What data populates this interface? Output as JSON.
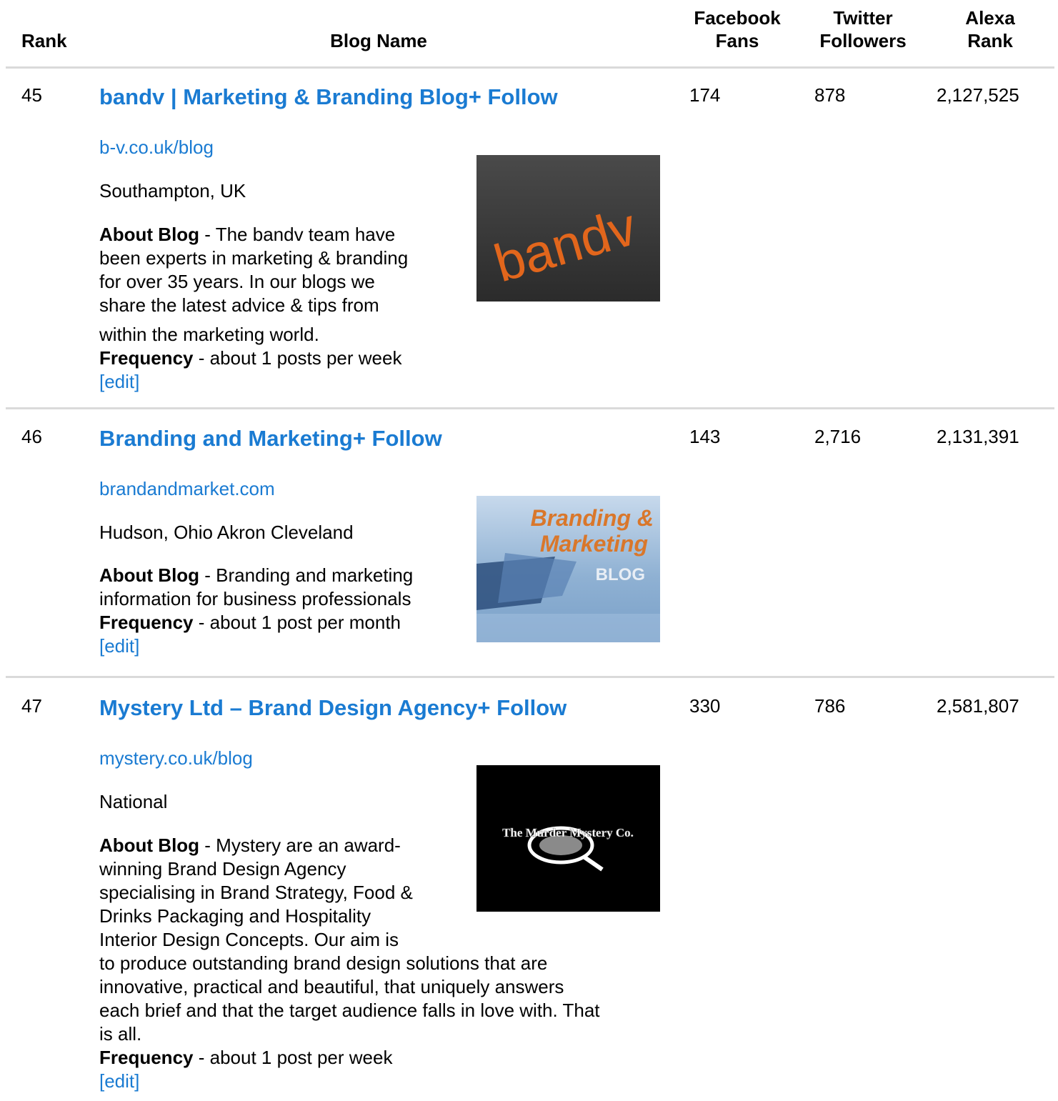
{
  "headers": {
    "rank": "Rank",
    "blog_name": "Blog Name",
    "facebook_line1": "Facebook",
    "facebook_line2": "Fans",
    "twitter_line1": "Twitter",
    "twitter_line2": "Followers",
    "alexa_line1": "Alexa",
    "alexa_line2": "Rank"
  },
  "rows": [
    {
      "rank": "45",
      "title": "bandv | Marketing & Branding Blog",
      "follow": "+ Follow",
      "url": "b-v.co.uk/blog",
      "location": "Southampton, UK",
      "about_label": "About Blog",
      "about_line1": " - The bandv team have",
      "about_line2": "been experts in marketing & branding",
      "about_line3": "for over 35 years. In our blogs we",
      "about_line4": "share the latest advice & tips from",
      "about_line5": "within the marketing world.",
      "frequency_label": "Frequency",
      "frequency_text": " - about 1 posts per week",
      "edit": "[edit]",
      "facebook": "174",
      "twitter": "878",
      "alexa": "2,127,525",
      "thumb_text": "bandv",
      "thumb_colors": {
        "bg": "#3a3a3a",
        "text": "#e2661c"
      }
    },
    {
      "rank": "46",
      "title": "Branding and Marketing",
      "follow": "+ Follow",
      "url": "brandandmarket.com",
      "location": "Hudson, Ohio Akron Cleveland",
      "about_label": "About Blog",
      "about_line1": " - Branding and marketing",
      "about_line2": "information for business professionals",
      "frequency_label": "Frequency",
      "frequency_text": " - about 1 post per month",
      "edit": "[edit]",
      "facebook": "143",
      "twitter": "2,716",
      "alexa": "2,131,391",
      "thumb_text_line1": "Branding &",
      "thumb_text_line2": "Marketing",
      "thumb_text_line3": "BLOG",
      "thumb_colors": {
        "bg": "#8fb1d3",
        "text": "#d9772b",
        "dark": "#2d4f7c"
      }
    },
    {
      "rank": "47",
      "title": "Mystery Ltd – Brand Design Agency",
      "follow": "+ Follow",
      "url": "mystery.co.uk/blog",
      "location": "National",
      "about_label": "About Blog",
      "about_line1": " - Mystery are an award-",
      "about_line2": "winning Brand Design Agency",
      "about_line3": "specialising in Brand Strategy, Food &",
      "about_line4": "Drinks Packaging and Hospitality",
      "about_line5": "Interior Design Concepts. Our aim is",
      "about_line6": "to produce outstanding brand design solutions that are",
      "about_line7": "innovative, practical and beautiful, that uniquely answers",
      "about_line8": "each brief and that the target audience falls in love with. That",
      "about_line9": "is all.",
      "frequency_label": "Frequency",
      "frequency_text": " - about 1 post per week",
      "edit": "[edit]",
      "facebook": "330",
      "twitter": "786",
      "alexa": "2,581,807",
      "thumb_text": "The Murder Mystery Co.",
      "thumb_colors": {
        "bg": "#000000",
        "text": "#ffffff"
      }
    }
  ]
}
